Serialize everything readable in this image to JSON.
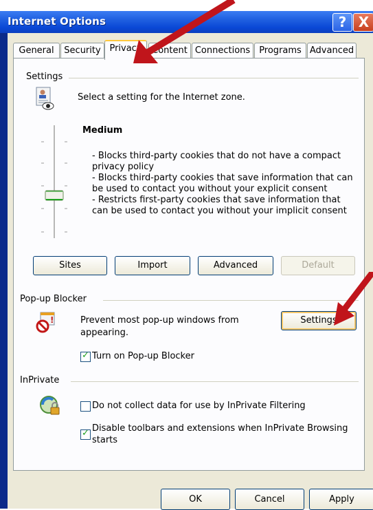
{
  "window": {
    "title": "Internet Options",
    "help_glyph": "?",
    "close_glyph": "X"
  },
  "tabs": [
    {
      "label": "General"
    },
    {
      "label": "Security"
    },
    {
      "label": "Privacy"
    },
    {
      "label": "Content"
    },
    {
      "label": "Connections"
    },
    {
      "label": "Programs"
    },
    {
      "label": "Advanced"
    }
  ],
  "settings": {
    "group_label": "Settings",
    "zone_text": "Select a setting for the Internet zone.",
    "level_title": "Medium",
    "level_lines": [
      "- Blocks third-party cookies that do not have a compact",
      "privacy policy",
      "- Blocks third-party cookies that save information that can",
      "be used to contact you without your explicit consent",
      "- Restricts first-party cookies that save information that",
      "can be used to contact you without your implicit consent"
    ],
    "buttons": {
      "sites": "Sites",
      "import": "Import",
      "advanced": "Advanced",
      "default": "Default"
    }
  },
  "popup": {
    "group_label": "Pop-up Blocker",
    "text_line1": "Prevent most pop-up windows from",
    "text_line2": "appearing.",
    "settings_button": "Settings",
    "turn_on_label": "Turn on Pop-up Blocker",
    "turn_on_checked": true
  },
  "inprivate": {
    "group_label": "InPrivate",
    "filtering_label": "Do not collect data for use by InPrivate Filtering",
    "filtering_checked": false,
    "disable_line1": "Disable toolbars and extensions when InPrivate Browsing",
    "disable_line2": "starts",
    "disable_checked": true
  },
  "footer": {
    "ok": "OK",
    "cancel": "Cancel",
    "apply": "Apply"
  },
  "annotation_color": "#c0151b"
}
